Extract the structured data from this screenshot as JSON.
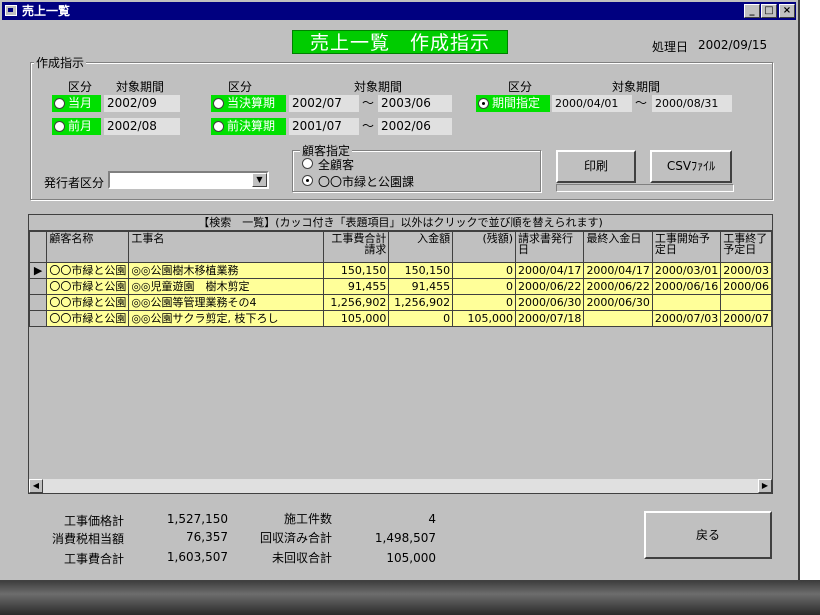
{
  "window": {
    "title": "売上一覧"
  },
  "page_title": "売上一覧　作成指示",
  "process_date": {
    "label": "処理日",
    "value": "2002/09/15"
  },
  "group_sakusei": "作成指示",
  "col_headers": {
    "kubun": "区分",
    "taisho": "対象期間"
  },
  "periods": {
    "tougetsu": {
      "label": "当月",
      "value": "2002/09"
    },
    "zengetsu": {
      "label": "前月",
      "value": "2002/08"
    },
    "toukessan": {
      "label": "当決算期",
      "from": "2002/07",
      "to": "2003/06"
    },
    "zenkessan": {
      "label": "前決算期",
      "from": "2001/07",
      "to": "2002/06"
    },
    "kikan": {
      "label": "期間指定",
      "from": "2000/04/01",
      "to": "2000/08/31"
    },
    "tilde": "～"
  },
  "customer": {
    "group_label": "顧客指定",
    "all_label": "全顧客",
    "selected_label": "〇〇市緑と公園課"
  },
  "issuer": {
    "label": "発行者区分",
    "value": ""
  },
  "buttons": {
    "print": "印刷",
    "csv": "CSVﾌｧｲﾙ",
    "back": "戻る"
  },
  "grid": {
    "caption": "【検索　一覧】(カッコ付き「表題項目」以外はクリックで並び順を替えられます)",
    "headers": [
      "顧客名称",
      "工事名",
      "工事費合計請求",
      "入金額",
      "(残額)",
      "請求書発行日",
      "最終入金日",
      "工事開始予定日",
      "工事終了予定日"
    ],
    "rows": [
      [
        "〇〇市緑と公園",
        "◎◎公園樹木移植業務",
        "150,150",
        "150,150",
        "0",
        "2000/04/17",
        "2000/04/17",
        "2000/03/01",
        "2000/03"
      ],
      [
        "〇〇市緑と公園",
        "◎◎児童遊園　樹木剪定",
        "91,455",
        "91,455",
        "0",
        "2000/06/22",
        "2000/06/22",
        "2000/06/16",
        "2000/06"
      ],
      [
        "〇〇市緑と公園",
        "◎◎公園等管理業務その4",
        "1,256,902",
        "1,256,902",
        "0",
        "2000/06/30",
        "2000/06/30",
        "",
        ""
      ],
      [
        "〇〇市緑と公園",
        "◎◎公園サクラ剪定, 枝下ろし",
        "105,000",
        "0",
        "105,000",
        "2000/07/18",
        "",
        "2000/07/03",
        "2000/07"
      ]
    ]
  },
  "totals": {
    "kouji_kakaku": {
      "label": "工事価格計",
      "value": "1,527,150"
    },
    "shouhizei": {
      "label": "消費税相当額",
      "value": "76,357"
    },
    "koujihi": {
      "label": "工事費合計",
      "value": "1,603,507"
    },
    "seko_kensu": {
      "label": "施工件数",
      "value": "4"
    },
    "kaishu_zumi": {
      "label": "回収済み合計",
      "value": "1,498,507"
    },
    "mikaishu": {
      "label": "未回収合計",
      "value": "105,000"
    }
  }
}
